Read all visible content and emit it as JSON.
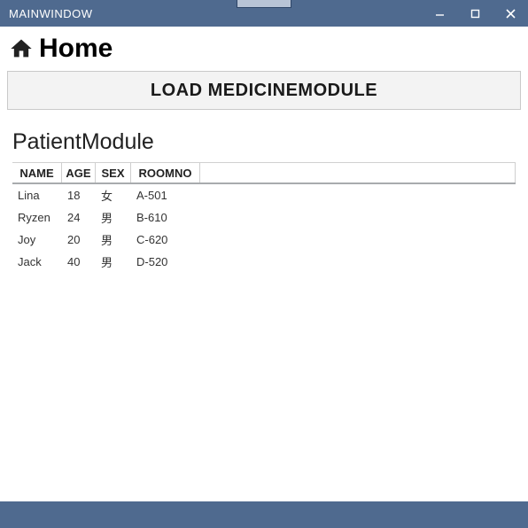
{
  "window": {
    "title": "MAINWINDOW"
  },
  "header": {
    "home_label": "Home",
    "load_button_label": "LOAD MEDICINEMODULE"
  },
  "module": {
    "title": "PatientModule",
    "columns": {
      "name": "NAME",
      "age": "AGE",
      "sex": "SEX",
      "room": "ROOMNO"
    },
    "rows": [
      {
        "name": "Lina",
        "age": "18",
        "sex": "女",
        "room": "A-501"
      },
      {
        "name": "Ryzen",
        "age": "24",
        "sex": "男",
        "room": "B-610"
      },
      {
        "name": "Joy",
        "age": "20",
        "sex": "男",
        "room": "C-620"
      },
      {
        "name": "Jack",
        "age": "40",
        "sex": "男",
        "room": "D-520"
      }
    ]
  }
}
